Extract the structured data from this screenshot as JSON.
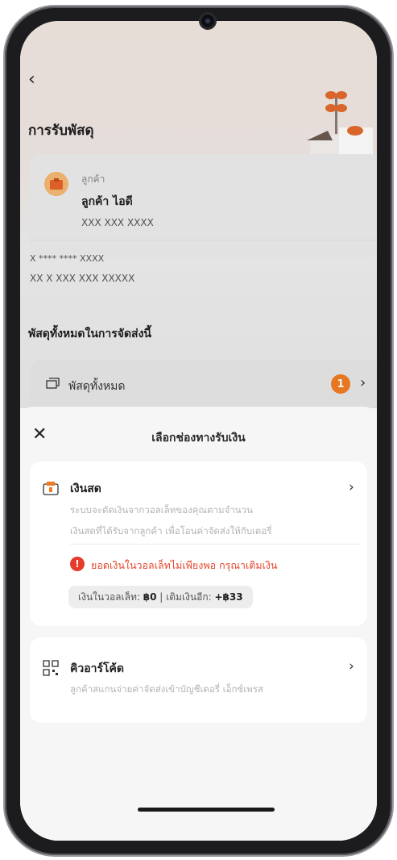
{
  "header": {
    "title": "การรับพัสดุ"
  },
  "customer": {
    "role_label": "ลูกค้า",
    "name": "ลูกค้า ไอดี",
    "phone": "XXX XXX XXXX",
    "address_line1": "X **** **** XXXX",
    "address_line2": "XX X XXX XXX XXXXX"
  },
  "parcels": {
    "section_label": "พัสดุทั้งหมดในการจัดส่งนี้",
    "row_label": "พัสดุทั้งหมด",
    "count": "1"
  },
  "sheet": {
    "title": "เลือกช่องทางรับเงิน",
    "cash": {
      "title": "เงินสด",
      "desc_line1": "ระบบจะตัดเงินจากวอลเล็ทของคุณตามจำนวน",
      "desc_line2": "เงินสดที่ได้รับจากลูกค้า เพื่อโอนค่าจัดส่งให้กับเดอรี่",
      "warning": "ยอดเงินในวอลเล็ทไม่เพียงพอ กรุณาเติมเงิน",
      "wallet_label": "เงินในวอลเล็ท:",
      "wallet_value": "฿0",
      "topup_label": "| เติมเงินอีก:",
      "topup_value": "+฿33"
    },
    "qr": {
      "title": "คิวอาร์โค้ด",
      "desc": "ลูกค้าสแกนจ่ายค่าจัดส่งเข้าบัญชีเดอรี่ เอ็กซ์เพรส"
    }
  },
  "colors": {
    "accent": "#f07b22",
    "warning": "#e53a2c"
  },
  "icons": {
    "back": "chevron-left-icon",
    "close": "close-icon",
    "cash": "cash-wallet-icon",
    "qr": "qr-code-icon",
    "parcel": "parcel-box-icon",
    "warning": "alert-icon"
  }
}
